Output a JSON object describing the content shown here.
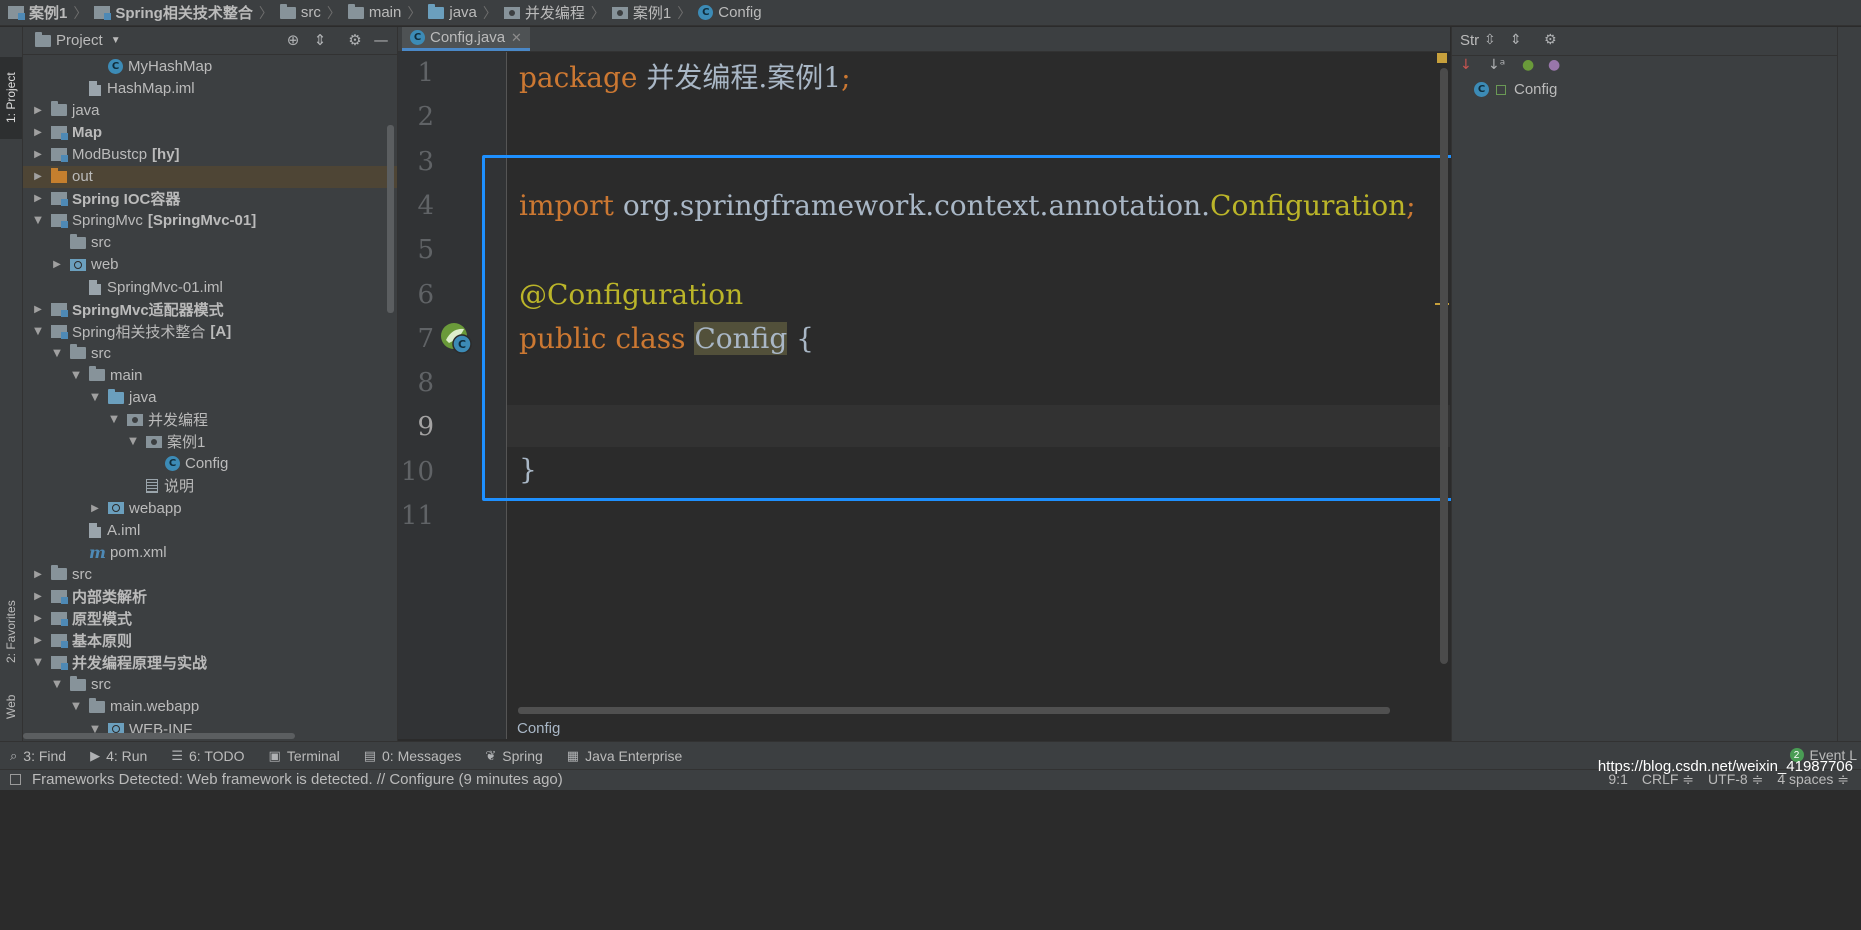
{
  "breadcrumb": [
    {
      "label": "案例1",
      "icon": "module-icon",
      "bold": true
    },
    {
      "label": "Spring相关技术整合",
      "icon": "module-icon",
      "bold": true
    },
    {
      "label": "src",
      "icon": "folder-icon",
      "bold": false
    },
    {
      "label": "main",
      "icon": "folder-icon",
      "bold": false
    },
    {
      "label": "java",
      "icon": "source-folder-icon",
      "bold": false
    },
    {
      "label": "并发编程",
      "icon": "package-icon",
      "bold": false
    },
    {
      "label": "案例1",
      "icon": "package-icon",
      "bold": false
    },
    {
      "label": "Config",
      "icon": "class-icon",
      "bold": false
    }
  ],
  "left_strip": {
    "project_tab": "1: Project",
    "favorites_tab": "2: Favorites",
    "web_tab": "Web"
  },
  "project_panel": {
    "title": "Project",
    "tree": [
      {
        "label": "MyHashMap",
        "depth": 4,
        "arrow": "",
        "icon": "class-icon",
        "bold": false
      },
      {
        "label": "HashMap.iml",
        "depth": 3,
        "arrow": "",
        "icon": "iml-file-icon",
        "bold": false
      },
      {
        "label": "java",
        "depth": 1,
        "arrow": "right",
        "icon": "folder-icon",
        "bold": false
      },
      {
        "label": "Map",
        "depth": 1,
        "arrow": "right",
        "icon": "module-icon",
        "bold": true
      },
      {
        "label": "ModBustcp",
        "suffix": "[hy]",
        "depth": 1,
        "arrow": "right",
        "icon": "module-icon",
        "bold": false
      },
      {
        "label": "out",
        "depth": 1,
        "arrow": "right",
        "icon": "excluded-folder-icon",
        "bold": false,
        "highlight": true
      },
      {
        "label": "Spring IOC容器",
        "depth": 1,
        "arrow": "right",
        "icon": "module-icon",
        "bold": true
      },
      {
        "label": "SpringMvc",
        "suffix": "[SpringMvc-01]",
        "depth": 1,
        "arrow": "down",
        "icon": "module-icon",
        "bold": false
      },
      {
        "label": "src",
        "depth": 2,
        "arrow": "",
        "icon": "folder-icon",
        "bold": false
      },
      {
        "label": "web",
        "depth": 2,
        "arrow": "right",
        "icon": "web-folder-icon",
        "bold": false
      },
      {
        "label": "SpringMvc-01.iml",
        "depth": 3,
        "arrow": "",
        "icon": "iml-file-icon",
        "bold": false
      },
      {
        "label": "SpringMvc适配器模式",
        "depth": 1,
        "arrow": "right",
        "icon": "module-icon",
        "bold": true
      },
      {
        "label": "Spring相关技术整合",
        "suffix": "[A]",
        "depth": 1,
        "arrow": "down",
        "icon": "module-icon",
        "bold": false
      },
      {
        "label": "src",
        "depth": 2,
        "arrow": "down",
        "icon": "folder-icon",
        "bold": false
      },
      {
        "label": "main",
        "depth": 3,
        "arrow": "down",
        "icon": "folder-icon",
        "bold": false
      },
      {
        "label": "java",
        "depth": 4,
        "arrow": "down",
        "icon": "source-folder-icon",
        "bold": false
      },
      {
        "label": "并发编程",
        "depth": 5,
        "arrow": "down",
        "icon": "package-icon",
        "bold": false
      },
      {
        "label": "案例1",
        "depth": 6,
        "arrow": "down",
        "icon": "package-icon",
        "bold": false
      },
      {
        "label": "Config",
        "depth": 7,
        "arrow": "",
        "icon": "class-icon",
        "bold": false
      },
      {
        "label": "说明",
        "depth": 6,
        "arrow": "",
        "icon": "text-file-icon",
        "bold": false
      },
      {
        "label": "webapp",
        "depth": 4,
        "arrow": "right",
        "icon": "web-folder-icon",
        "bold": false
      },
      {
        "label": "A.iml",
        "depth": 3,
        "arrow": "",
        "icon": "iml-file-icon",
        "bold": false
      },
      {
        "label": "pom.xml",
        "depth": 3,
        "arrow": "",
        "icon": "maven-icon",
        "bold": false
      },
      {
        "label": "src",
        "depth": 1,
        "arrow": "right",
        "icon": "folder-icon",
        "bold": false
      },
      {
        "label": "内部类解析",
        "depth": 1,
        "arrow": "right",
        "icon": "module-icon",
        "bold": true
      },
      {
        "label": "原型模式",
        "depth": 1,
        "arrow": "right",
        "icon": "module-icon",
        "bold": true
      },
      {
        "label": "基本原则",
        "depth": 1,
        "arrow": "right",
        "icon": "module-icon",
        "bold": true
      },
      {
        "label": "并发编程原理与实战",
        "depth": 1,
        "arrow": "down",
        "icon": "module-icon",
        "bold": true
      },
      {
        "label": "src",
        "depth": 2,
        "arrow": "down",
        "icon": "folder-icon",
        "bold": false
      },
      {
        "label": "main.webapp",
        "depth": 3,
        "arrow": "down",
        "icon": "folder-icon",
        "bold": false
      },
      {
        "label": "WEB-INF",
        "depth": 4,
        "arrow": "down",
        "icon": "web-folder-icon",
        "bold": false
      }
    ]
  },
  "editor": {
    "tab_label": "Config.java",
    "line_numbers": [
      "1",
      "2",
      "3",
      "4",
      "5",
      "6",
      "7",
      "8",
      "9",
      "10",
      "11"
    ],
    "current_line": "9",
    "code": {
      "l1_kw": "package ",
      "l1_txt": "并发编程.案例1",
      "l1_end": ";",
      "l4_kw": "import ",
      "l4_txt": "org.springframework.context.annotation.",
      "l4_anno": "Configuration",
      "l4_end": ";",
      "l6_anno": "@Configuration",
      "l7_kw": "public class ",
      "l7_cls": "Config",
      "l7_brace": " {",
      "l10_brace": "}"
    },
    "footer": "Config"
  },
  "structure_panel": {
    "title": "Str",
    "item": "Config"
  },
  "bottom_tools": [
    {
      "label": "3: Find",
      "icon": "search-icon",
      "glyph": "⌕"
    },
    {
      "label": "4: Run",
      "icon": "run-icon",
      "glyph": "▶"
    },
    {
      "label": "6: TODO",
      "icon": "todo-icon",
      "glyph": "☰"
    },
    {
      "label": "Terminal",
      "icon": "terminal-icon",
      "glyph": "▣"
    },
    {
      "label": "0: Messages",
      "icon": "messages-icon",
      "glyph": "▤"
    },
    {
      "label": "Spring",
      "icon": "spring-icon",
      "glyph": "❦"
    },
    {
      "label": "Java Enterprise",
      "icon": "java-enterprise-icon",
      "glyph": "▦"
    }
  ],
  "event_log": {
    "label": "Event L",
    "count": "2"
  },
  "status": {
    "message": "Frameworks Detected: Web framework is detected. // Configure (9 minutes ago)",
    "position": "9:1",
    "line_sep": "CRLF ≑",
    "encoding": "UTF-8 ≑",
    "indent": "4 spaces ≑",
    "watermark": "https://blog.csdn.net/weixin_41987706"
  },
  "colors": {
    "keyword": "#cc7832",
    "annotation": "#bbb529",
    "text": "#a9b7c6",
    "highlight_box": "#1e90ff"
  }
}
